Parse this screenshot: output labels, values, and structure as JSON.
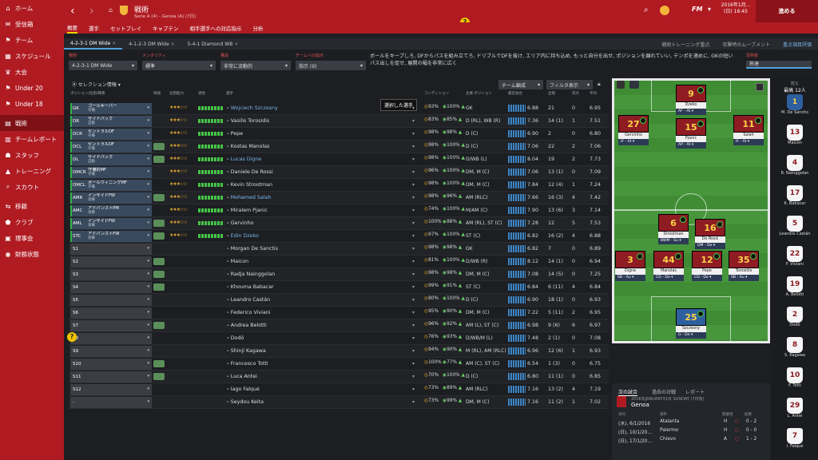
{
  "sidebar": {
    "items": [
      {
        "icon": "⌂",
        "label": "ホーム",
        "active": false
      },
      {
        "icon": "✉",
        "label": "受信箱",
        "active": false
      },
      {
        "icon": "⚑",
        "label": "チーム",
        "active": false
      },
      {
        "icon": "▦",
        "label": "スケジュール",
        "active": false
      },
      {
        "icon": "♛",
        "label": "大会",
        "active": false
      },
      {
        "icon": "⚑",
        "label": "Under 20",
        "active": false
      },
      {
        "icon": "⚑",
        "label": "Under 18",
        "active": false
      },
      {
        "icon": "▤",
        "label": "戦術",
        "active": true
      },
      {
        "icon": "▥",
        "label": "チームレポート",
        "active": false
      },
      {
        "icon": "☗",
        "label": "スタッフ",
        "active": false
      },
      {
        "icon": "▲",
        "label": "トレーニング",
        "active": false
      },
      {
        "icon": "⌕",
        "label": "スカウト",
        "active": false
      },
      {
        "icon": "⇆",
        "label": "移籍",
        "active": false
      },
      {
        "icon": "⬟",
        "label": "クラブ",
        "active": false
      },
      {
        "icon": "▣",
        "label": "理事会",
        "active": false
      },
      {
        "icon": "◉",
        "label": "財務状態",
        "active": false
      }
    ]
  },
  "header": {
    "title": "戦術",
    "subtitle": "Serie A (4) - Genoa (A) (7日)",
    "date_line1": "2016年1月...",
    "date_line2": "(日) 16:45",
    "continue_label": "進める",
    "fm_label": "FM"
  },
  "subnav": [
    "概要",
    "選手",
    "セットプレイ",
    "キャプテン",
    "相手選手への対応指示",
    "分析"
  ],
  "tactic_tabs": [
    "4-2-3-1 DM Wide",
    "4-1-2-3 DM Wide",
    "5-4-1 Diamond WB"
  ],
  "tactic_right": [
    "戦術トレーニング重点",
    "攻撃時のムーブメント",
    "重点項目評価"
  ],
  "controls": {
    "formation_label": "戦術",
    "formation": "4-2-3-1 DM Wide",
    "mentality_label": "メンタリティ",
    "mentality": "標準",
    "shape_label": "構造",
    "shape": "非常に流動的",
    "instr_label": "チームへの指示",
    "instr": "指示 (9)",
    "familiarity_label": "習熟度",
    "familiarity": "熟達"
  },
  "description": "ボールをキープしろ, DFからパスを組み立てろ, ドリブルでDFを抜け, エリア内に持ち込め, もっと自分を出せ, ポジションを離れていい, テンポを速めに, GKの短いパス出しを促せ, 展開の幅を非常に広く",
  "tooltip": "選択した選手",
  "table": {
    "selection_label": "セレクション情報",
    "team_label": "チーム編成",
    "filter_label": "フィルタ表示",
    "headers": [
      "ポジション/役割/職務",
      "情報",
      "役割能力",
      "適性",
      "選手",
      "コンディション",
      "主要.ポジション",
      "最近試合",
      "出場",
      "得点",
      "平均"
    ]
  },
  "players": [
    {
      "code": "GK",
      "role": "ゴールキーパー",
      "duty": "守備",
      "name": "Wojciech Szczesny",
      "link": true,
      "stars": "★★★☆☆",
      "fam": "93%",
      "fit": "100%",
      "pos": "GK",
      "rat": "6.88",
      "apps": "21",
      "gls": "0",
      "avr": "6.95",
      "tag": false,
      "starter": true
    },
    {
      "code": "DR",
      "role": "サイドバック",
      "duty": "自動",
      "name": "Vasilis Torosidis",
      "link": false,
      "stars": "★★★☆☆",
      "fam": "83%",
      "fit": "85%",
      "pos": "D (RL), WB (R)",
      "rat": "7.36",
      "apps": "14 (1)",
      "gls": "1",
      "avr": "7.51",
      "tag": false,
      "starter": true
    },
    {
      "code": "DCR",
      "role": "セントラルDF",
      "duty": "守備",
      "name": "Pepe",
      "link": false,
      "stars": "★★★☆☆",
      "fam": "98%",
      "fit": "98%",
      "pos": "D (C)",
      "rat": "6.90",
      "apps": "2",
      "gls": "0",
      "avr": "6.80",
      "tag": false,
      "starter": true
    },
    {
      "code": "DCL",
      "role": "セントラルDF",
      "duty": "守備",
      "name": "Kostas Manolas",
      "link": false,
      "stars": "★★★☆☆",
      "fam": "98%",
      "fit": "100%",
      "pos": "D (C)",
      "rat": "7.06",
      "apps": "22",
      "gls": "2",
      "avr": "7.06",
      "tag": true,
      "starter": true
    },
    {
      "code": "DL",
      "role": "サイドバック",
      "duty": "自動",
      "name": "Lucas Digne",
      "link": true,
      "stars": "★★★☆☆",
      "fam": "98%",
      "fit": "100%",
      "pos": "D/WB (L)",
      "rat": "8.04",
      "apps": "19",
      "gls": "2",
      "avr": "7.73",
      "tag": true,
      "starter": true
    },
    {
      "code": "DMCR",
      "role": "守備的MF",
      "duty": "守備",
      "name": "Daniele De Rossi",
      "link": false,
      "stars": "★★★☆☆",
      "fam": "96%",
      "fit": "100%",
      "pos": "DM, M (C)",
      "rat": "7.06",
      "apps": "13 (1)",
      "gls": "0",
      "avr": "7.09",
      "tag": false,
      "starter": true
    },
    {
      "code": "DMCL",
      "role": "ボールウィニングMF",
      "duty": "守備",
      "name": "Kevin Strootman",
      "link": false,
      "stars": "★★★☆☆",
      "fam": "98%",
      "fit": "100%",
      "pos": "DM, M (C)",
      "rat": "7.84",
      "apps": "12 (4)",
      "gls": "1",
      "avr": "7.24",
      "tag": false,
      "starter": true
    },
    {
      "code": "AMR",
      "role": "インサイドFW",
      "duty": "攻撃",
      "name": "Mohamed Salah",
      "link": true,
      "stars": "★★★☆☆",
      "fam": "98%",
      "fit": "96%",
      "pos": "AM (RLC)",
      "rat": "7.66",
      "apps": "16 (3)",
      "gls": "4",
      "avr": "7.42",
      "tag": true,
      "starter": true
    },
    {
      "code": "AMC",
      "role": "アドバンストPM",
      "duty": "攻撃",
      "name": "Miralem Pjanic",
      "link": false,
      "stars": "★★★☆☆",
      "fam": "74%",
      "fit": "100%",
      "pos": "M/AM (C)",
      "rat": "7.90",
      "apps": "13 (6)",
      "gls": "3",
      "avr": "7.14",
      "tag": false,
      "starter": true
    },
    {
      "code": "AML",
      "role": "インサイドFW",
      "duty": "攻撃",
      "name": "Gervinho",
      "link": false,
      "stars": "★★★☆☆",
      "fam": "100%",
      "fit": "88%",
      "pos": "AM (RL), ST (C)",
      "rat": "7.28",
      "apps": "12",
      "gls": "5",
      "avr": "7.53",
      "tag": true,
      "starter": true
    },
    {
      "code": "STC",
      "role": "アドバンストFW",
      "duty": "攻撃",
      "name": "Edin Dzeko",
      "link": true,
      "stars": "★★★☆☆",
      "fam": "97%",
      "fit": "100%",
      "pos": "ST (C)",
      "rat": "6.82",
      "apps": "16 (2)",
      "gls": "4",
      "avr": "6.88",
      "tag": true,
      "starter": true
    },
    {
      "code": "S1",
      "role": "",
      "duty": "",
      "name": "Morgan De Sanctis",
      "link": false,
      "stars": "",
      "fam": "98%",
      "fit": "98%",
      "pos": "GK",
      "rat": "6.82",
      "apps": "7",
      "gls": "0",
      "avr": "6.89",
      "tag": false,
      "starter": false
    },
    {
      "code": "S2",
      "role": "",
      "duty": "",
      "name": "Maicon",
      "link": false,
      "stars": "",
      "fam": "81%",
      "fit": "100%",
      "pos": "D/WB (R)",
      "rat": "8.12",
      "apps": "14 (1)",
      "gls": "0",
      "avr": "6.94",
      "tag": true,
      "starter": false
    },
    {
      "code": "S3",
      "role": "",
      "duty": "",
      "name": "Radja Nainggolan",
      "link": false,
      "stars": "",
      "fam": "98%",
      "fit": "98%",
      "pos": "DM, M (C)",
      "rat": "7.08",
      "apps": "14 (5)",
      "gls": "0",
      "avr": "7.25",
      "tag": true,
      "starter": false
    },
    {
      "code": "S4",
      "role": "",
      "duty": "",
      "name": "Khouma Babacar",
      "link": false,
      "stars": "",
      "fam": "99%",
      "fit": "91%",
      "pos": "ST (C)",
      "rat": "6.84",
      "apps": "6 (11)",
      "gls": "4",
      "avr": "6.84",
      "tag": true,
      "starter": false
    },
    {
      "code": "S5",
      "role": "",
      "duty": "",
      "name": "Leandro Castán",
      "link": false,
      "stars": "",
      "fam": "80%",
      "fit": "100%",
      "pos": "D (C)",
      "rat": "6.90",
      "apps": "18 (1)",
      "gls": "0",
      "avr": "6.93",
      "tag": false,
      "starter": false
    },
    {
      "code": "S6",
      "role": "",
      "duty": "",
      "name": "Federico Viviani",
      "link": false,
      "stars": "",
      "fam": "95%",
      "fit": "90%",
      "pos": "DM, M (C)",
      "rat": "7.22",
      "apps": "5 (11)",
      "gls": "2",
      "avr": "6.95",
      "tag": false,
      "starter": false
    },
    {
      "code": "S7",
      "role": "",
      "duty": "",
      "name": "Andrea Belotti",
      "link": false,
      "stars": "",
      "fam": "96%",
      "fit": "92%",
      "pos": "AM (L), ST (C)",
      "rat": "6.98",
      "apps": "9 (6)",
      "gls": "6",
      "avr": "6.97",
      "tag": true,
      "starter": false
    },
    {
      "code": "S8",
      "role": "",
      "duty": "",
      "name": "Dodô",
      "link": false,
      "stars": "",
      "fam": "76%",
      "fit": "93%",
      "pos": "D/WB/M (L)",
      "rat": "7.48",
      "apps": "2 (1)",
      "gls": "0",
      "avr": "7.08",
      "tag": false,
      "starter": false
    },
    {
      "code": "S9",
      "role": "",
      "duty": "",
      "name": "Shinji Kagawa",
      "link": false,
      "stars": "",
      "fam": "94%",
      "fit": "90%",
      "pos": "M (RL), AM (RLC)",
      "rat": "6.96",
      "apps": "12 (6)",
      "gls": "1",
      "avr": "6.93",
      "tag": false,
      "starter": false
    },
    {
      "code": "S10",
      "role": "",
      "duty": "",
      "name": "Francesco Totti",
      "link": false,
      "stars": "",
      "fam": "100%",
      "fit": "77%",
      "pos": "AM (C), ST (C)",
      "rat": "6.54",
      "apps": "1 (3)",
      "gls": "0",
      "avr": "6.75",
      "tag": true,
      "starter": false
    },
    {
      "code": "S11",
      "role": "",
      "duty": "",
      "name": "Luca Antei",
      "link": false,
      "stars": "",
      "fam": "70%",
      "fit": "100%",
      "pos": "D (C)",
      "rat": "6.80",
      "apps": "11 (1)",
      "gls": "0",
      "avr": "6.85",
      "tag": true,
      "starter": false
    },
    {
      "code": "S12",
      "role": "",
      "duty": "",
      "name": "Iago Falqué",
      "link": false,
      "stars": "",
      "fam": "73%",
      "fit": "89%",
      "pos": "AM (RLC)",
      "rat": "7.16",
      "apps": "13 (2)",
      "gls": "4",
      "avr": "7.19",
      "tag": false,
      "starter": false
    },
    {
      "code": "-",
      "role": "",
      "duty": "",
      "name": "Seydou Keita",
      "link": false,
      "stars": "",
      "fam": "73%",
      "fit": "99%",
      "pos": "DM, M (C)",
      "rat": "7.16",
      "apps": "11 (2)",
      "gls": "1",
      "avr": "7.02",
      "tag": false,
      "starter": false
    }
  ],
  "pitch": [
    {
      "num": "9",
      "name": "Dzeko",
      "role": "AF - At",
      "gk": false
    },
    {
      "num": "27",
      "name": "Gervinho",
      "role": "IF - At",
      "gk": false
    },
    {
      "num": "15",
      "name": "Pjanic",
      "role": "AP - At",
      "gk": false
    },
    {
      "num": "11",
      "name": "Salah",
      "role": "IF - At",
      "gk": false
    },
    {
      "num": "6",
      "name": "Strootman",
      "role": "BWM - Su",
      "gk": false
    },
    {
      "num": "16",
      "name": "De Rossi",
      "role": "DM - De",
      "gk": false
    },
    {
      "num": "3",
      "name": "Digne",
      "role": "SB - Au",
      "gk": false
    },
    {
      "num": "44",
      "name": "Manolas",
      "role": "CD - De",
      "gk": false
    },
    {
      "num": "12",
      "name": "Pepe",
      "role": "CD - De",
      "gk": false
    },
    {
      "num": "35",
      "name": "Torosidis",
      "role": "SB - Au",
      "gk": false
    },
    {
      "num": "25",
      "name": "Szczesny",
      "role": "G - De",
      "gk": true
    }
  ],
  "bench": {
    "title": "控え",
    "count": "最高 12人",
    "players": [
      {
        "num": "1",
        "name": "M. De Sanctis"
      },
      {
        "num": "13",
        "name": "Maicon"
      },
      {
        "num": "4",
        "name": "R. Nainggolan"
      },
      {
        "num": "17",
        "name": "K. Babacar"
      },
      {
        "num": "5",
        "name": "Leandro Castán"
      },
      {
        "num": "22",
        "name": "F. Viviani"
      },
      {
        "num": "19",
        "name": "A. Belotti"
      },
      {
        "num": "2",
        "name": "Dodô"
      },
      {
        "num": "8",
        "name": "S. Kagawa"
      },
      {
        "num": "10",
        "name": "F. Totti"
      },
      {
        "num": "29",
        "name": "L. Antei"
      },
      {
        "num": "7",
        "name": "I. Falqué"
      }
    ]
  },
  "fixtures": {
    "tabs": [
      "次の試合",
      "過去の対戦",
      "レポート"
    ],
    "next_date": "2016年JANUARY31日 SUNDAY (7日後)",
    "next_opponent": "Genoa",
    "col_date": "日付",
    "col_opp": "相手",
    "col_venue": "開催地",
    "col_result": "結果",
    "rows": [
      {
        "date": "(水), 6/1/2016",
        "opp": "Atalanta",
        "venue": "H",
        "score": "0 - 2"
      },
      {
        "date": "(日), 10/1/20...",
        "opp": "Palermo",
        "venue": "H",
        "score": "0 - 0"
      },
      {
        "date": "(日), 17/1/20...",
        "opp": "Chievo",
        "venue": "A",
        "score": "1 - 2"
      }
    ]
  },
  "colors": {
    "brand": "#b01b22",
    "accent": "#ffd200",
    "link": "#7ab6ea"
  }
}
